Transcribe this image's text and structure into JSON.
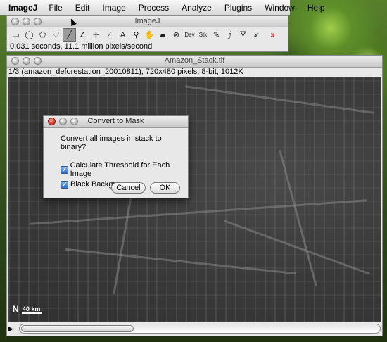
{
  "menubar": {
    "items": [
      "ImageJ",
      "File",
      "Edit",
      "Image",
      "Process",
      "Analyze",
      "Plugins",
      "Window",
      "Help"
    ]
  },
  "imagej_window": {
    "title": "ImageJ",
    "tools": [
      {
        "name": "rectangle-tool-icon",
        "glyph": "▭"
      },
      {
        "name": "oval-tool-icon",
        "glyph": "◯"
      },
      {
        "name": "polygon-tool-icon",
        "glyph": "⬠"
      },
      {
        "name": "freehand-tool-icon",
        "glyph": "♡"
      },
      {
        "name": "line-tool-icon",
        "glyph": "╱"
      },
      {
        "name": "angle-tool-icon",
        "glyph": "∠"
      },
      {
        "name": "point-tool-icon",
        "glyph": "✛"
      },
      {
        "name": "wand-tool-icon",
        "glyph": "⁄"
      },
      {
        "name": "text-tool-icon",
        "glyph": "A"
      },
      {
        "name": "magnifier-tool-icon",
        "glyph": "⚲"
      },
      {
        "name": "hand-tool-icon",
        "glyph": "✋"
      },
      {
        "name": "color-picker-tool-icon",
        "glyph": "▰"
      },
      {
        "name": "stop-tool-icon",
        "glyph": "⊗"
      },
      {
        "name": "dev-tool-icon",
        "glyph": "Dev"
      },
      {
        "name": "stack-tool-icon",
        "glyph": "Stk"
      },
      {
        "name": "pencil-tool-icon",
        "glyph": "✎"
      },
      {
        "name": "brush-tool-icon",
        "glyph": "ⅉ"
      },
      {
        "name": "flood-fill-tool-icon",
        "glyph": "⛛"
      },
      {
        "name": "arrow-tool-icon",
        "glyph": "➶"
      },
      {
        "name": "more-tools-icon",
        "glyph": "»"
      }
    ],
    "status": "0.031 seconds, 11.1 million pixels/second"
  },
  "image_window": {
    "title": "Amazon_Stack.tif",
    "info": "1/3 (amazon_deforestation_20010811); 720x480 pixels; 8-bit; 1012K",
    "scale_label": "40 km",
    "north_label": "N"
  },
  "dialog": {
    "title": "Convert to Mask",
    "message": "Convert all images in stack to binary?",
    "options": [
      {
        "label": "Calculate Threshold for Each Image",
        "checked": true
      },
      {
        "label": "Black Background",
        "checked": true
      }
    ],
    "cancel_label": "Cancel",
    "ok_label": "OK"
  }
}
